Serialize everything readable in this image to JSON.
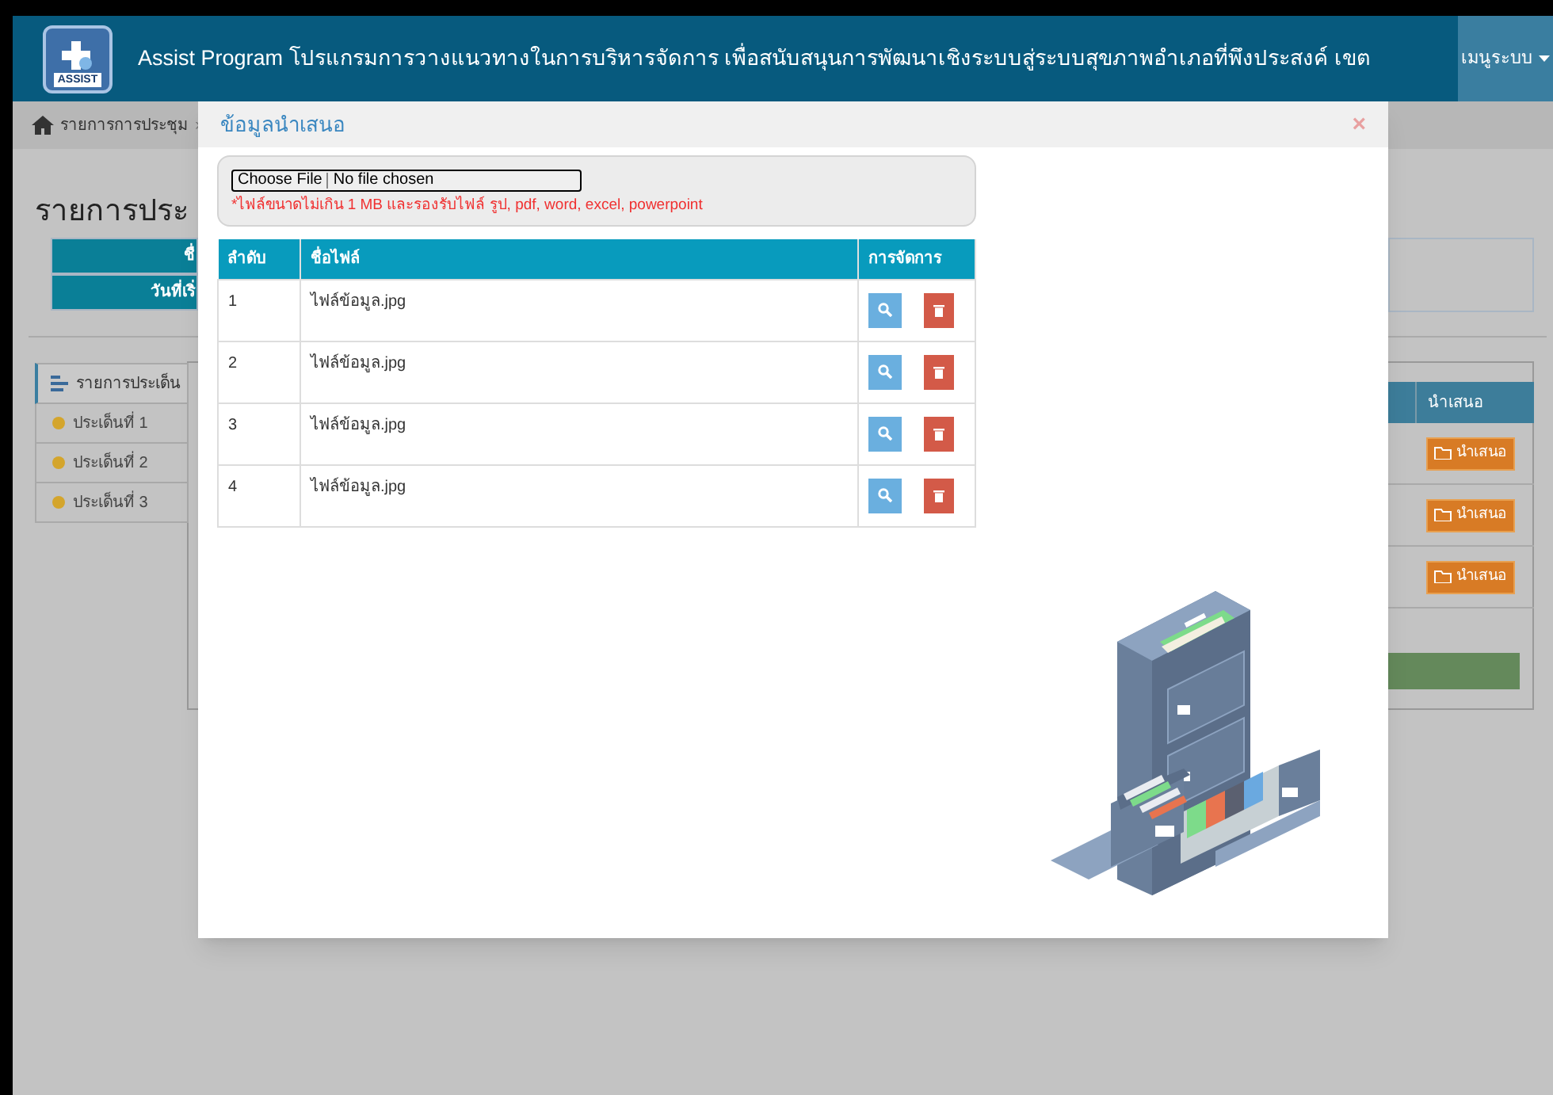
{
  "header": {
    "logo_text": "ASSIST",
    "title": "Assist Program โปรแกรมการวางแนวทางในการบริหารจัดการ เพื่อสนับสนุนการพัฒนาเชิงระบบสู่ระบบสุขภาพอำเภอที่พึงประสงค์ เขต",
    "menu": "เมนูระบบ"
  },
  "breadcrumb": {
    "items": [
      "รายการการประชุม"
    ],
    "separator": "›"
  },
  "page_title": "รายการประ",
  "info_labels": [
    "ชื่",
    "วันที่เริ่"
  ],
  "sidebar": {
    "heading": "รายการประเด็น",
    "items": [
      "ประเด็นที่ 1",
      "ประเด็นที่ 2",
      "ประเด็นที่ 3"
    ]
  },
  "topics_table": {
    "column": "นำเสนอ",
    "buttons": [
      "นำเสนอ",
      "นำเสนอ",
      "นำเสนอ"
    ]
  },
  "modal": {
    "title": "ข้อมูลนำเสนอ",
    "close": "×",
    "file_input": {
      "button": "Choose File",
      "value": "No file chosen"
    },
    "note": "*ไฟล์ขนาดไม่เกิน 1 MB และรองรับไฟล์ รูป, pdf, word, excel, powerpoint",
    "table": {
      "columns": [
        "ลำดับ",
        "ชื่อไฟล์",
        "การจัดการ"
      ],
      "rows": [
        {
          "index": "1",
          "file": "ไฟล์ข้อมูล.jpg"
        },
        {
          "index": "2",
          "file": "ไฟล์ข้อมูล.jpg"
        },
        {
          "index": "3",
          "file": "ไฟล์ข้อมูล.jpg"
        },
        {
          "index": "4",
          "file": "ไฟล์ข้อมูล.jpg"
        }
      ]
    }
  }
}
